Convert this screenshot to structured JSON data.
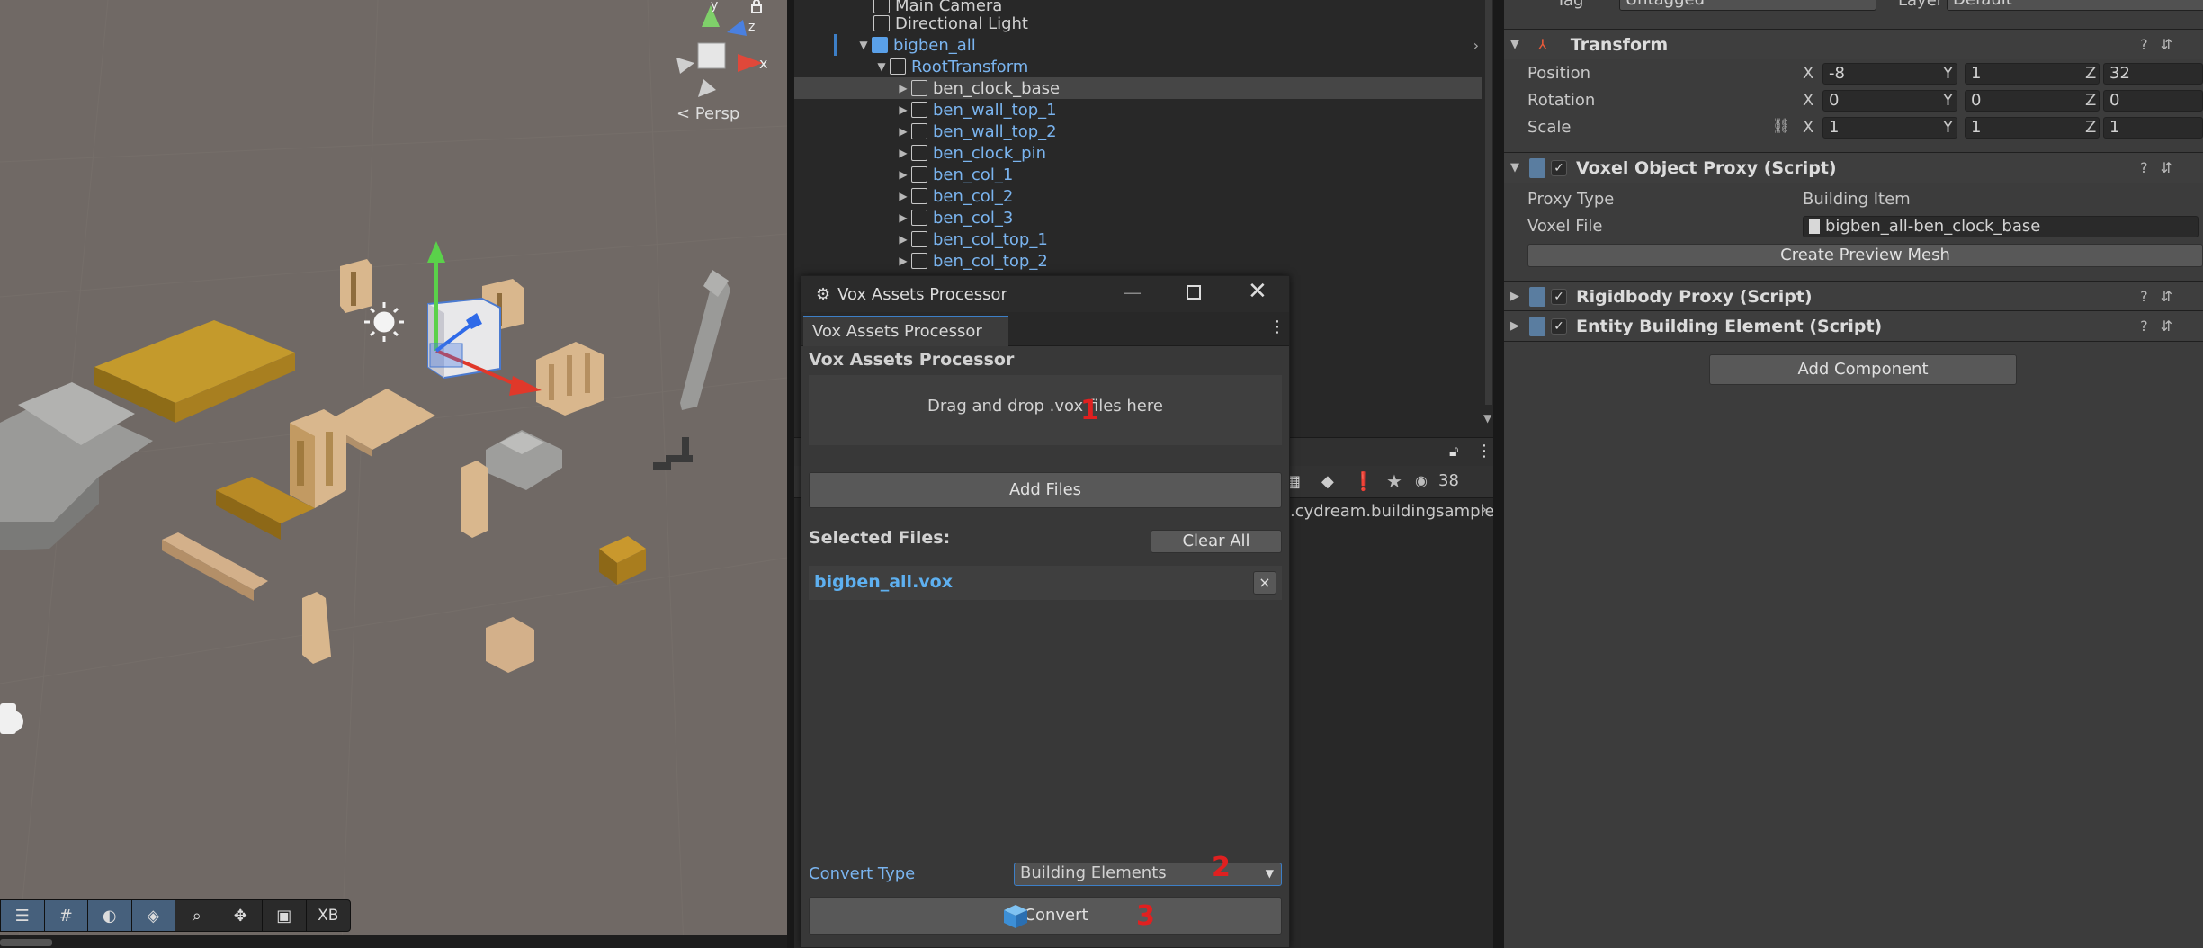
{
  "scene": {
    "persp_label": "< Persp",
    "gizmo": {
      "x": "x",
      "y": "y",
      "z": "z"
    },
    "tools": [
      "sliders-icon",
      "grid-icon",
      "globe-icon",
      "layers-icon",
      "search-icon",
      "move-icon",
      "camera-icon",
      "XB"
    ]
  },
  "hierarchy": {
    "items": [
      {
        "label": "Main Camera"
      },
      {
        "label": "Directional Light"
      },
      {
        "label": "bigben_all"
      },
      {
        "label": "RootTransform"
      },
      {
        "label": "ben_clock_base"
      },
      {
        "label": "ben_wall_top_1"
      },
      {
        "label": "ben_wall_top_2"
      },
      {
        "label": "ben_clock_pin"
      },
      {
        "label": "ben_col_1"
      },
      {
        "label": "ben_col_2"
      },
      {
        "label": "ben_col_3"
      },
      {
        "label": "ben_col_top_1"
      },
      {
        "label": "ben_col_top_2"
      }
    ]
  },
  "project": {
    "count": "38",
    "breadcrumb": ".cydream.buildingsample"
  },
  "inspector": {
    "tag_label": "Tag",
    "tag_value": "Untagged",
    "layer_label": "Layer",
    "layer_value": "Default",
    "transform": {
      "title": "Transform",
      "position_label": "Position",
      "rotation_label": "Rotation",
      "scale_label": "Scale",
      "position": [
        "-8",
        "1",
        "32"
      ],
      "rotation": [
        "0",
        "0",
        "0"
      ],
      "scale": [
        "1",
        "1",
        "1"
      ],
      "axes": [
        "X",
        "Y",
        "Z"
      ]
    },
    "voxel_proxy": {
      "title": "Voxel Object Proxy (Script)",
      "proxy_type_label": "Proxy Type",
      "proxy_type_value": "Building Item",
      "voxel_file_label": "Voxel File",
      "voxel_file_value": "bigben_all-ben_clock_base",
      "preview_button": "Create Preview Mesh"
    },
    "rigidbody": {
      "title": "Rigidbody Proxy (Script)"
    },
    "entity": {
      "title": "Entity Building Element (Script)"
    },
    "add_component": "Add Component"
  },
  "dialog": {
    "title": "Vox Assets Processor",
    "tab": "Vox Assets Processor",
    "heading": "Vox Assets Processor",
    "drop_text": "Drag and drop .vox files here",
    "add_files": "Add Files",
    "selected_files_label": "Selected Files:",
    "clear_all": "Clear All",
    "files": [
      "bigben_all.vox"
    ],
    "remove_symbol": "×",
    "convert_type_label": "Convert Type",
    "convert_type_value": "Building Elements",
    "convert_button": "Convert",
    "markers": [
      "1",
      "2",
      "3"
    ]
  }
}
